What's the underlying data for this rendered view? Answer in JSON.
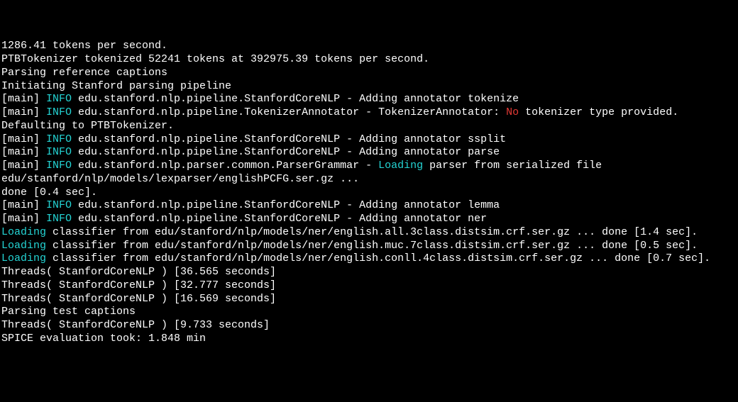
{
  "lines": [
    [
      {
        "c": "w",
        "t": "1286.41 tokens per second."
      }
    ],
    [
      {
        "c": "w",
        "t": "PTBTokenizer tokenized 52241 tokens at 392975.39 tokens per second."
      }
    ],
    [
      {
        "c": "w",
        "t": "Parsing reference captions"
      }
    ],
    [
      {
        "c": "w",
        "t": "Initiating Stanford parsing pipeline"
      }
    ],
    [
      {
        "c": "w",
        "t": "[main] "
      },
      {
        "c": "c",
        "t": "INFO"
      },
      {
        "c": "w",
        "t": " edu.stanford.nlp.pipeline.StanfordCoreNLP - Adding annotator tokenize"
      }
    ],
    [
      {
        "c": "w",
        "t": "[main] "
      },
      {
        "c": "c",
        "t": "INFO"
      },
      {
        "c": "w",
        "t": " edu.stanford.nlp.pipeline.TokenizerAnnotator - TokenizerAnnotator: "
      },
      {
        "c": "r",
        "t": "No"
      },
      {
        "c": "w",
        "t": " tokenizer type provided. Defaulting to PTBTokenizer."
      }
    ],
    [
      {
        "c": "w",
        "t": "[main] "
      },
      {
        "c": "c",
        "t": "INFO"
      },
      {
        "c": "w",
        "t": " edu.stanford.nlp.pipeline.StanfordCoreNLP - Adding annotator ssplit"
      }
    ],
    [
      {
        "c": "w",
        "t": "[main] "
      },
      {
        "c": "c",
        "t": "INFO"
      },
      {
        "c": "w",
        "t": " edu.stanford.nlp.pipeline.StanfordCoreNLP - Adding annotator parse"
      }
    ],
    [
      {
        "c": "w",
        "t": "[main] "
      },
      {
        "c": "c",
        "t": "INFO"
      },
      {
        "c": "w",
        "t": " edu.stanford.nlp.parser.common.ParserGrammar - "
      },
      {
        "c": "c",
        "t": "Loading"
      },
      {
        "c": "w",
        "t": " parser from serialized file edu/stanford/nlp/models/lexparser/englishPCFG.ser.gz ..."
      }
    ],
    [
      {
        "c": "w",
        "t": "done [0.4 sec]."
      }
    ],
    [
      {
        "c": "w",
        "t": "[main] "
      },
      {
        "c": "c",
        "t": "INFO"
      },
      {
        "c": "w",
        "t": " edu.stanford.nlp.pipeline.StanfordCoreNLP - Adding annotator lemma"
      }
    ],
    [
      {
        "c": "w",
        "t": "[main] "
      },
      {
        "c": "c",
        "t": "INFO"
      },
      {
        "c": "w",
        "t": " edu.stanford.nlp.pipeline.StanfordCoreNLP - Adding annotator ner"
      }
    ],
    [
      {
        "c": "c",
        "t": "Loading"
      },
      {
        "c": "w",
        "t": " classifier from edu/stanford/nlp/models/ner/english.all.3class.distsim.crf.ser.gz ... done [1.4 sec]."
      }
    ],
    [
      {
        "c": "c",
        "t": "Loading"
      },
      {
        "c": "w",
        "t": " classifier from edu/stanford/nlp/models/ner/english.muc.7class.distsim.crf.ser.gz ... done [0.5 sec]."
      }
    ],
    [
      {
        "c": "c",
        "t": "Loading"
      },
      {
        "c": "w",
        "t": " classifier from edu/stanford/nlp/models/ner/english.conll.4class.distsim.crf.ser.gz ... done [0.7 sec]."
      }
    ],
    [
      {
        "c": "w",
        "t": "Threads( StanfordCoreNLP ) [36.565 seconds]"
      }
    ],
    [
      {
        "c": "w",
        "t": "Threads( StanfordCoreNLP ) [32.777 seconds]"
      }
    ],
    [
      {
        "c": "w",
        "t": "Threads( StanfordCoreNLP ) [16.569 seconds]"
      }
    ],
    [
      {
        "c": "w",
        "t": "Parsing test captions"
      }
    ],
    [
      {
        "c": "w",
        "t": "Threads( StanfordCoreNLP ) [9.733 seconds]"
      }
    ],
    [
      {
        "c": "w",
        "t": "SPICE evaluation took: 1.848 min"
      }
    ]
  ]
}
